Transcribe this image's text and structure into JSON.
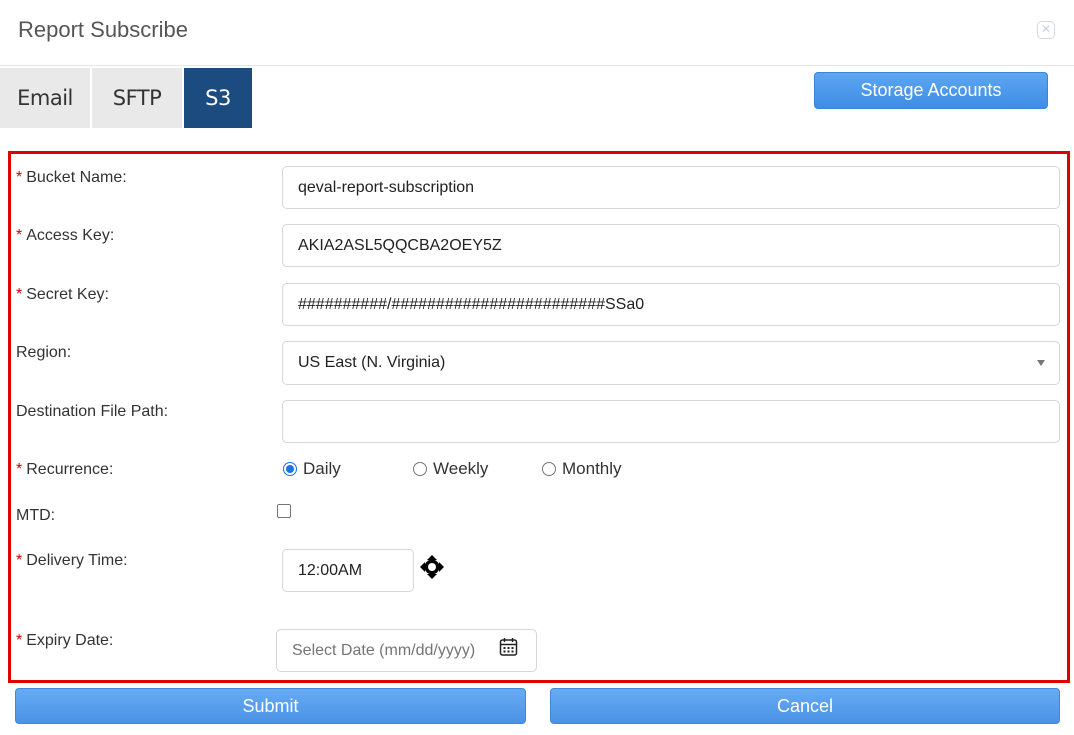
{
  "dialog": {
    "title": "Report Subscribe",
    "close_icon": "close-icon"
  },
  "tabs": [
    {
      "label": "Email",
      "active": false
    },
    {
      "label": "SFTP",
      "active": false
    },
    {
      "label": "S3",
      "active": true
    }
  ],
  "toolbar": {
    "storage_accounts_label": "Storage Accounts"
  },
  "form": {
    "required_marker": "*",
    "bucket_name": {
      "label": "Bucket Name:",
      "value": "qeval-report-subscription",
      "required": true
    },
    "access_key": {
      "label": "Access Key:",
      "value": "AKIA2ASL5QQCBA2OEY5Z",
      "required": true
    },
    "secret_key": {
      "label": "Secret Key:",
      "value": "##########/########################SSa0",
      "required": true
    },
    "region": {
      "label": "Region:",
      "value": "US East (N. Virginia)",
      "required": false
    },
    "destination_path": {
      "label": "Destination File Path:",
      "value": "",
      "required": false
    },
    "recurrence": {
      "label": "Recurrence:",
      "required": true,
      "options": [
        "Daily",
        "Weekly",
        "Monthly"
      ],
      "selected": "Daily"
    },
    "mtd": {
      "label": "MTD:",
      "checked": false
    },
    "delivery_time": {
      "label": "Delivery Time:",
      "value": "12:00AM",
      "required": true
    },
    "expiry_date": {
      "label": "Expiry Date:",
      "placeholder": "Select Date (mm/dd/yyyy)",
      "required": true
    }
  },
  "actions": {
    "submit_label": "Submit",
    "cancel_label": "Cancel"
  },
  "colors": {
    "active_tab": "#1c4b80",
    "button_blue": "#4a92e6",
    "highlight_border": "#e00000",
    "required": "#cc0000"
  }
}
